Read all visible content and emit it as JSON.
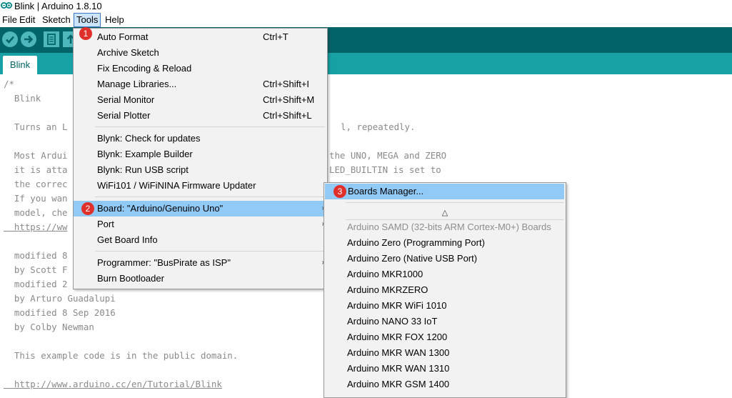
{
  "window": {
    "title": "Blink | Arduino 1.8.10"
  },
  "menubar": {
    "file": "File",
    "edit": "Edit",
    "sketch": "Sketch",
    "tools": "Tools",
    "help": "Help"
  },
  "tabs": [
    {
      "label": "Blink"
    }
  ],
  "code": [
    "/*",
    "  Blink",
    "",
    "  Turns an L",
    "",
    "  Most Ardui",
    "  it is atta",
    "  the correc",
    "  If you wan",
    "  model, che",
    "  https://ww",
    "",
    "  modified 8",
    "  by Scott F",
    "  modified 2",
    "  by Arturo Guadalupi",
    "  modified 8 Sep 2016",
    "  by Colby Newman",
    "",
    "  This example code is in the public domain.",
    "",
    "  http://www.arduino.cc/en/Tutorial/Blink"
  ],
  "code_right": [
    "l, repeatedly.",
    "the UNO, MEGA and ZERO",
    "LED_BUILTIN is set to"
  ],
  "tools_menu": {
    "items": [
      {
        "label": "Auto Format",
        "shortcut": "Ctrl+T"
      },
      {
        "label": "Archive Sketch",
        "shortcut": ""
      },
      {
        "label": "Fix Encoding & Reload",
        "shortcut": ""
      },
      {
        "label": "Manage Libraries...",
        "shortcut": "Ctrl+Shift+I"
      },
      {
        "label": "Serial Monitor",
        "shortcut": "Ctrl+Shift+M"
      },
      {
        "label": "Serial Plotter",
        "shortcut": "Ctrl+Shift+L"
      },
      {
        "label": "Blynk: Check for updates",
        "shortcut": ""
      },
      {
        "label": "Blynk: Example Builder",
        "shortcut": ""
      },
      {
        "label": "Blynk: Run USB script",
        "shortcut": ""
      },
      {
        "label": "WiFi101 / WiFiNINA Firmware Updater",
        "shortcut": ""
      },
      {
        "label": "Board: \"Arduino/Genuino Uno\"",
        "shortcut": ""
      },
      {
        "label": "Port",
        "shortcut": ""
      },
      {
        "label": "Get Board Info",
        "shortcut": ""
      },
      {
        "label": "Programmer: \"BusPirate as ISP\"",
        "shortcut": ""
      },
      {
        "label": "Burn Bootloader",
        "shortcut": ""
      }
    ],
    "arrow": "›"
  },
  "boards_menu": {
    "manager": "Boards Manager...",
    "scroll_up": "△",
    "section_header": "Arduino SAMD (32-bits ARM Cortex-M0+) Boards",
    "boards": [
      "Arduino Zero (Programming Port)",
      "Arduino Zero (Native USB Port)",
      "Arduino MKR1000",
      "Arduino MKRZERO",
      "Arduino MKR WiFi 1010",
      "Arduino NANO 33 IoT",
      "Arduino MKR FOX 1200",
      "Arduino MKR WAN 1300",
      "Arduino MKR WAN 1310",
      "Arduino MKR GSM 1400"
    ]
  },
  "badges": {
    "one": "1",
    "two": "2",
    "three": "3"
  },
  "colors": {
    "toolbar": "#006468",
    "tabstrip": "#17a1a5",
    "highlight": "#91c9f7",
    "badge": "#e0302c"
  }
}
